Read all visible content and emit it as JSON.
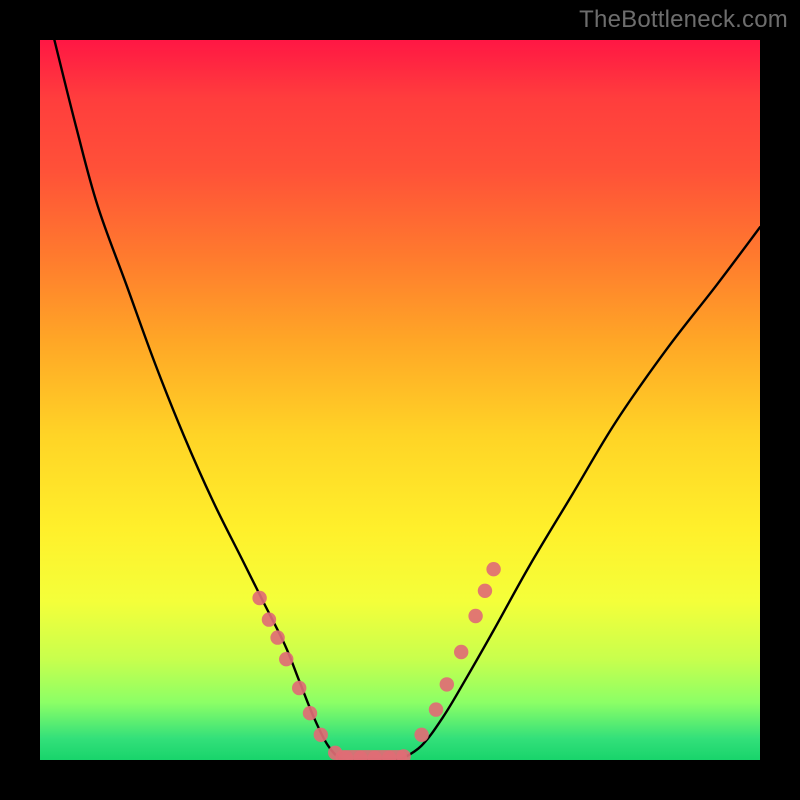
{
  "watermark": "TheBottleneck.com",
  "chart_data": {
    "type": "line",
    "title": "",
    "xlabel": "",
    "ylabel": "",
    "xlim": [
      0,
      100
    ],
    "ylim": [
      0,
      100
    ],
    "grid": false,
    "legend": false,
    "series": [
      {
        "name": "left-curve",
        "x": [
          2,
          5,
          8,
          12,
          16,
          20,
          24,
          28,
          31,
          34,
          36,
          38,
          40,
          42
        ],
        "y": [
          100,
          88,
          77,
          66,
          55,
          45,
          36,
          28,
          22,
          16,
          11,
          6,
          2,
          0
        ]
      },
      {
        "name": "right-curve",
        "x": [
          50,
          53,
          56,
          59,
          63,
          68,
          74,
          80,
          87,
          94,
          100
        ],
        "y": [
          0,
          2,
          6,
          11,
          18,
          27,
          37,
          47,
          57,
          66,
          74
        ]
      },
      {
        "name": "trough",
        "x": [
          42,
          44,
          46,
          48,
          50
        ],
        "y": [
          0,
          0,
          0,
          0,
          0
        ]
      }
    ],
    "markers": {
      "name": "dots",
      "color": "#e06c75",
      "points": [
        {
          "x": 30.5,
          "y": 22.5
        },
        {
          "x": 31.8,
          "y": 19.5
        },
        {
          "x": 33.0,
          "y": 17.0
        },
        {
          "x": 34.2,
          "y": 14.0
        },
        {
          "x": 36.0,
          "y": 10.0
        },
        {
          "x": 37.5,
          "y": 6.5
        },
        {
          "x": 39.0,
          "y": 3.5
        },
        {
          "x": 41.0,
          "y": 1.0
        },
        {
          "x": 42.5,
          "y": 0.3
        },
        {
          "x": 44.5,
          "y": 0.3
        },
        {
          "x": 46.5,
          "y": 0.3
        },
        {
          "x": 48.5,
          "y": 0.3
        },
        {
          "x": 50.5,
          "y": 0.5
        },
        {
          "x": 53.0,
          "y": 3.5
        },
        {
          "x": 55.0,
          "y": 7.0
        },
        {
          "x": 56.5,
          "y": 10.5
        },
        {
          "x": 58.5,
          "y": 15.0
        },
        {
          "x": 60.5,
          "y": 20.0
        },
        {
          "x": 61.8,
          "y": 23.5
        },
        {
          "x": 63.0,
          "y": 26.5
        }
      ]
    },
    "axis_note": "Axes are unlabeled; values are percent of plot area (0–100)."
  }
}
